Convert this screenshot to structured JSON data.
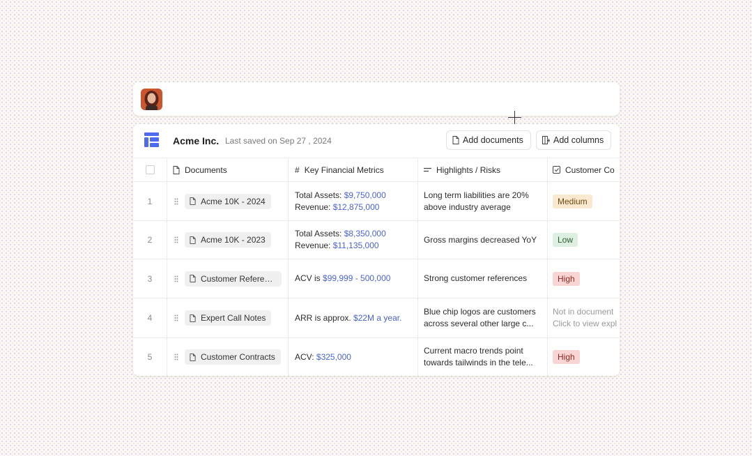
{
  "top_bar": {
    "avatar": "user-avatar-photo"
  },
  "sheet": {
    "title": "Acme Inc.",
    "last_saved": "Last saved on Sep 27 , 2024",
    "add_documents": "Add documents",
    "add_columns": "Add columns"
  },
  "columns": {
    "documents": "Documents",
    "metrics": "Key Financial Metrics",
    "highlights": "Highlights / Risks",
    "customer": "Customer Co"
  },
  "rows": [
    {
      "num": "1",
      "doc": "Acme 10K - 2024",
      "metrics": [
        {
          "label": "Total Assets: ",
          "value": "$9,750,000"
        },
        {
          "label": "Revenue: ",
          "value": "$12,875,000"
        }
      ],
      "highlight": [
        "Long term liabilities are 20%",
        "above industry average"
      ],
      "customer": "Medium"
    },
    {
      "num": "2",
      "doc": "Acme 10K - 2023",
      "metrics": [
        {
          "label": "Total Assets: ",
          "value": "$8,350,000"
        },
        {
          "label": "Revenue: ",
          "value": "$11,135,000"
        }
      ],
      "highlight": [
        "Gross margins decreased YoY"
      ],
      "customer": "Low"
    },
    {
      "num": "3",
      "doc": "Customer References",
      "metrics": [
        {
          "label": "ACV is ",
          "value": "$99,999 - 500,000"
        }
      ],
      "highlight": [
        "Strong customer references"
      ],
      "customer": "High"
    },
    {
      "num": "4",
      "doc": "Expert Call Notes",
      "metrics": [
        {
          "label": "ARR is approx. ",
          "value": "$22M a year."
        }
      ],
      "highlight": [
        "Blue chip logos are customers",
        "across several other large c..."
      ],
      "customer_note": [
        "Not in document",
        "Click to view expl"
      ]
    },
    {
      "num": "5",
      "doc": "Customer Contracts",
      "metrics": [
        {
          "label": "ACV: ",
          "value": "$325,000"
        }
      ],
      "highlight": [
        "Current macro trends point",
        "towards tailwinds in the tele..."
      ],
      "customer": "High"
    }
  ],
  "colors": {
    "link": "#4a63d4",
    "logo": "#4f6bed"
  }
}
